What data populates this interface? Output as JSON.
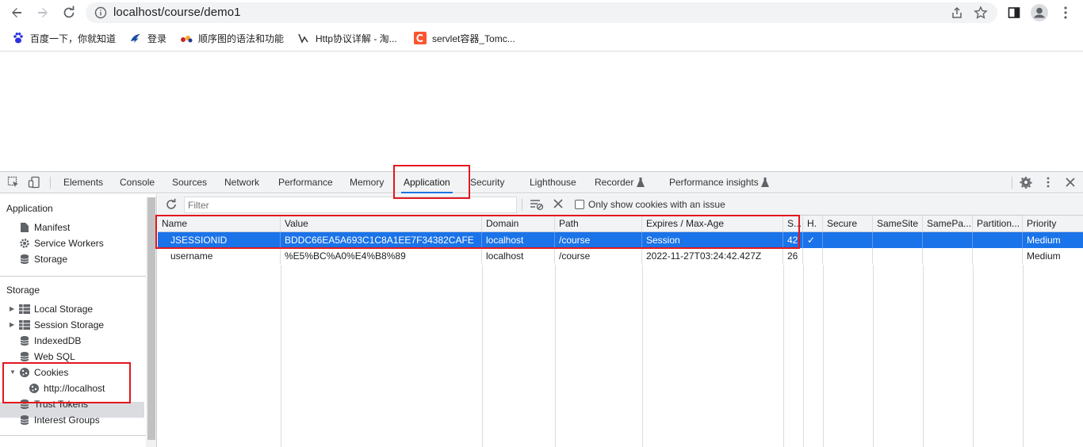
{
  "browser": {
    "url": "localhost/course/demo1"
  },
  "bookmarks": [
    {
      "label": "百度一下，你就知道",
      "icon": "baidu-paw-icon"
    },
    {
      "label": "登录",
      "icon": "login-icon"
    },
    {
      "label": "顺序图的语法和功能",
      "icon": "plantuml-icon"
    },
    {
      "label": "Http协议详解 - 淘...",
      "icon": "http-icon"
    },
    {
      "label": "servlet容器_Tomc...",
      "icon": "csdn-c-icon"
    }
  ],
  "devtools": {
    "tabs": [
      "Elements",
      "Console",
      "Sources",
      "Network",
      "Performance",
      "Memory",
      "Application",
      "Security",
      "Lighthouse",
      "Recorder",
      "Performance insights"
    ],
    "active_tab": "Application",
    "sidebar": {
      "application_header": "Application",
      "application_items": [
        "Manifest",
        "Service Workers",
        "Storage"
      ],
      "storage_header": "Storage",
      "storage_items": [
        "Local Storage",
        "Session Storage",
        "IndexedDB",
        "Web SQL",
        "Cookies",
        "http://localhost",
        "Trust Tokens",
        "Interest Groups"
      ]
    },
    "cookies": {
      "filter_placeholder": "Filter",
      "only_issue_label": "Only show cookies with an issue",
      "columns": [
        "Name",
        "Value",
        "Domain",
        "Path",
        "Expires / Max-Age",
        "S...",
        "H.",
        "Secure",
        "SameSite",
        "SamePa...",
        "Partition...",
        "Priority"
      ],
      "rows": [
        {
          "name": "JSESSIONID",
          "value": "BDDC66EA5A693C1C8A1EE7F34382CAFE",
          "domain": "localhost",
          "path": "/course",
          "expires": "Session",
          "size": "42",
          "httponly": "✓",
          "secure": "",
          "samesite": "",
          "sameparty": "",
          "partition": "",
          "priority": "Medium"
        },
        {
          "name": "username",
          "value": "%E5%BC%A0%E4%B8%89",
          "domain": "localhost",
          "path": "/course",
          "expires": "2022-11-27T03:24:42.427Z",
          "size": "26",
          "httponly": "",
          "secure": "",
          "samesite": "",
          "sameparty": "",
          "partition": "",
          "priority": "Medium"
        }
      ],
      "selected_row": 0
    }
  },
  "colors": {
    "accent": "#1a73e8",
    "annotation": "#e3171e"
  }
}
